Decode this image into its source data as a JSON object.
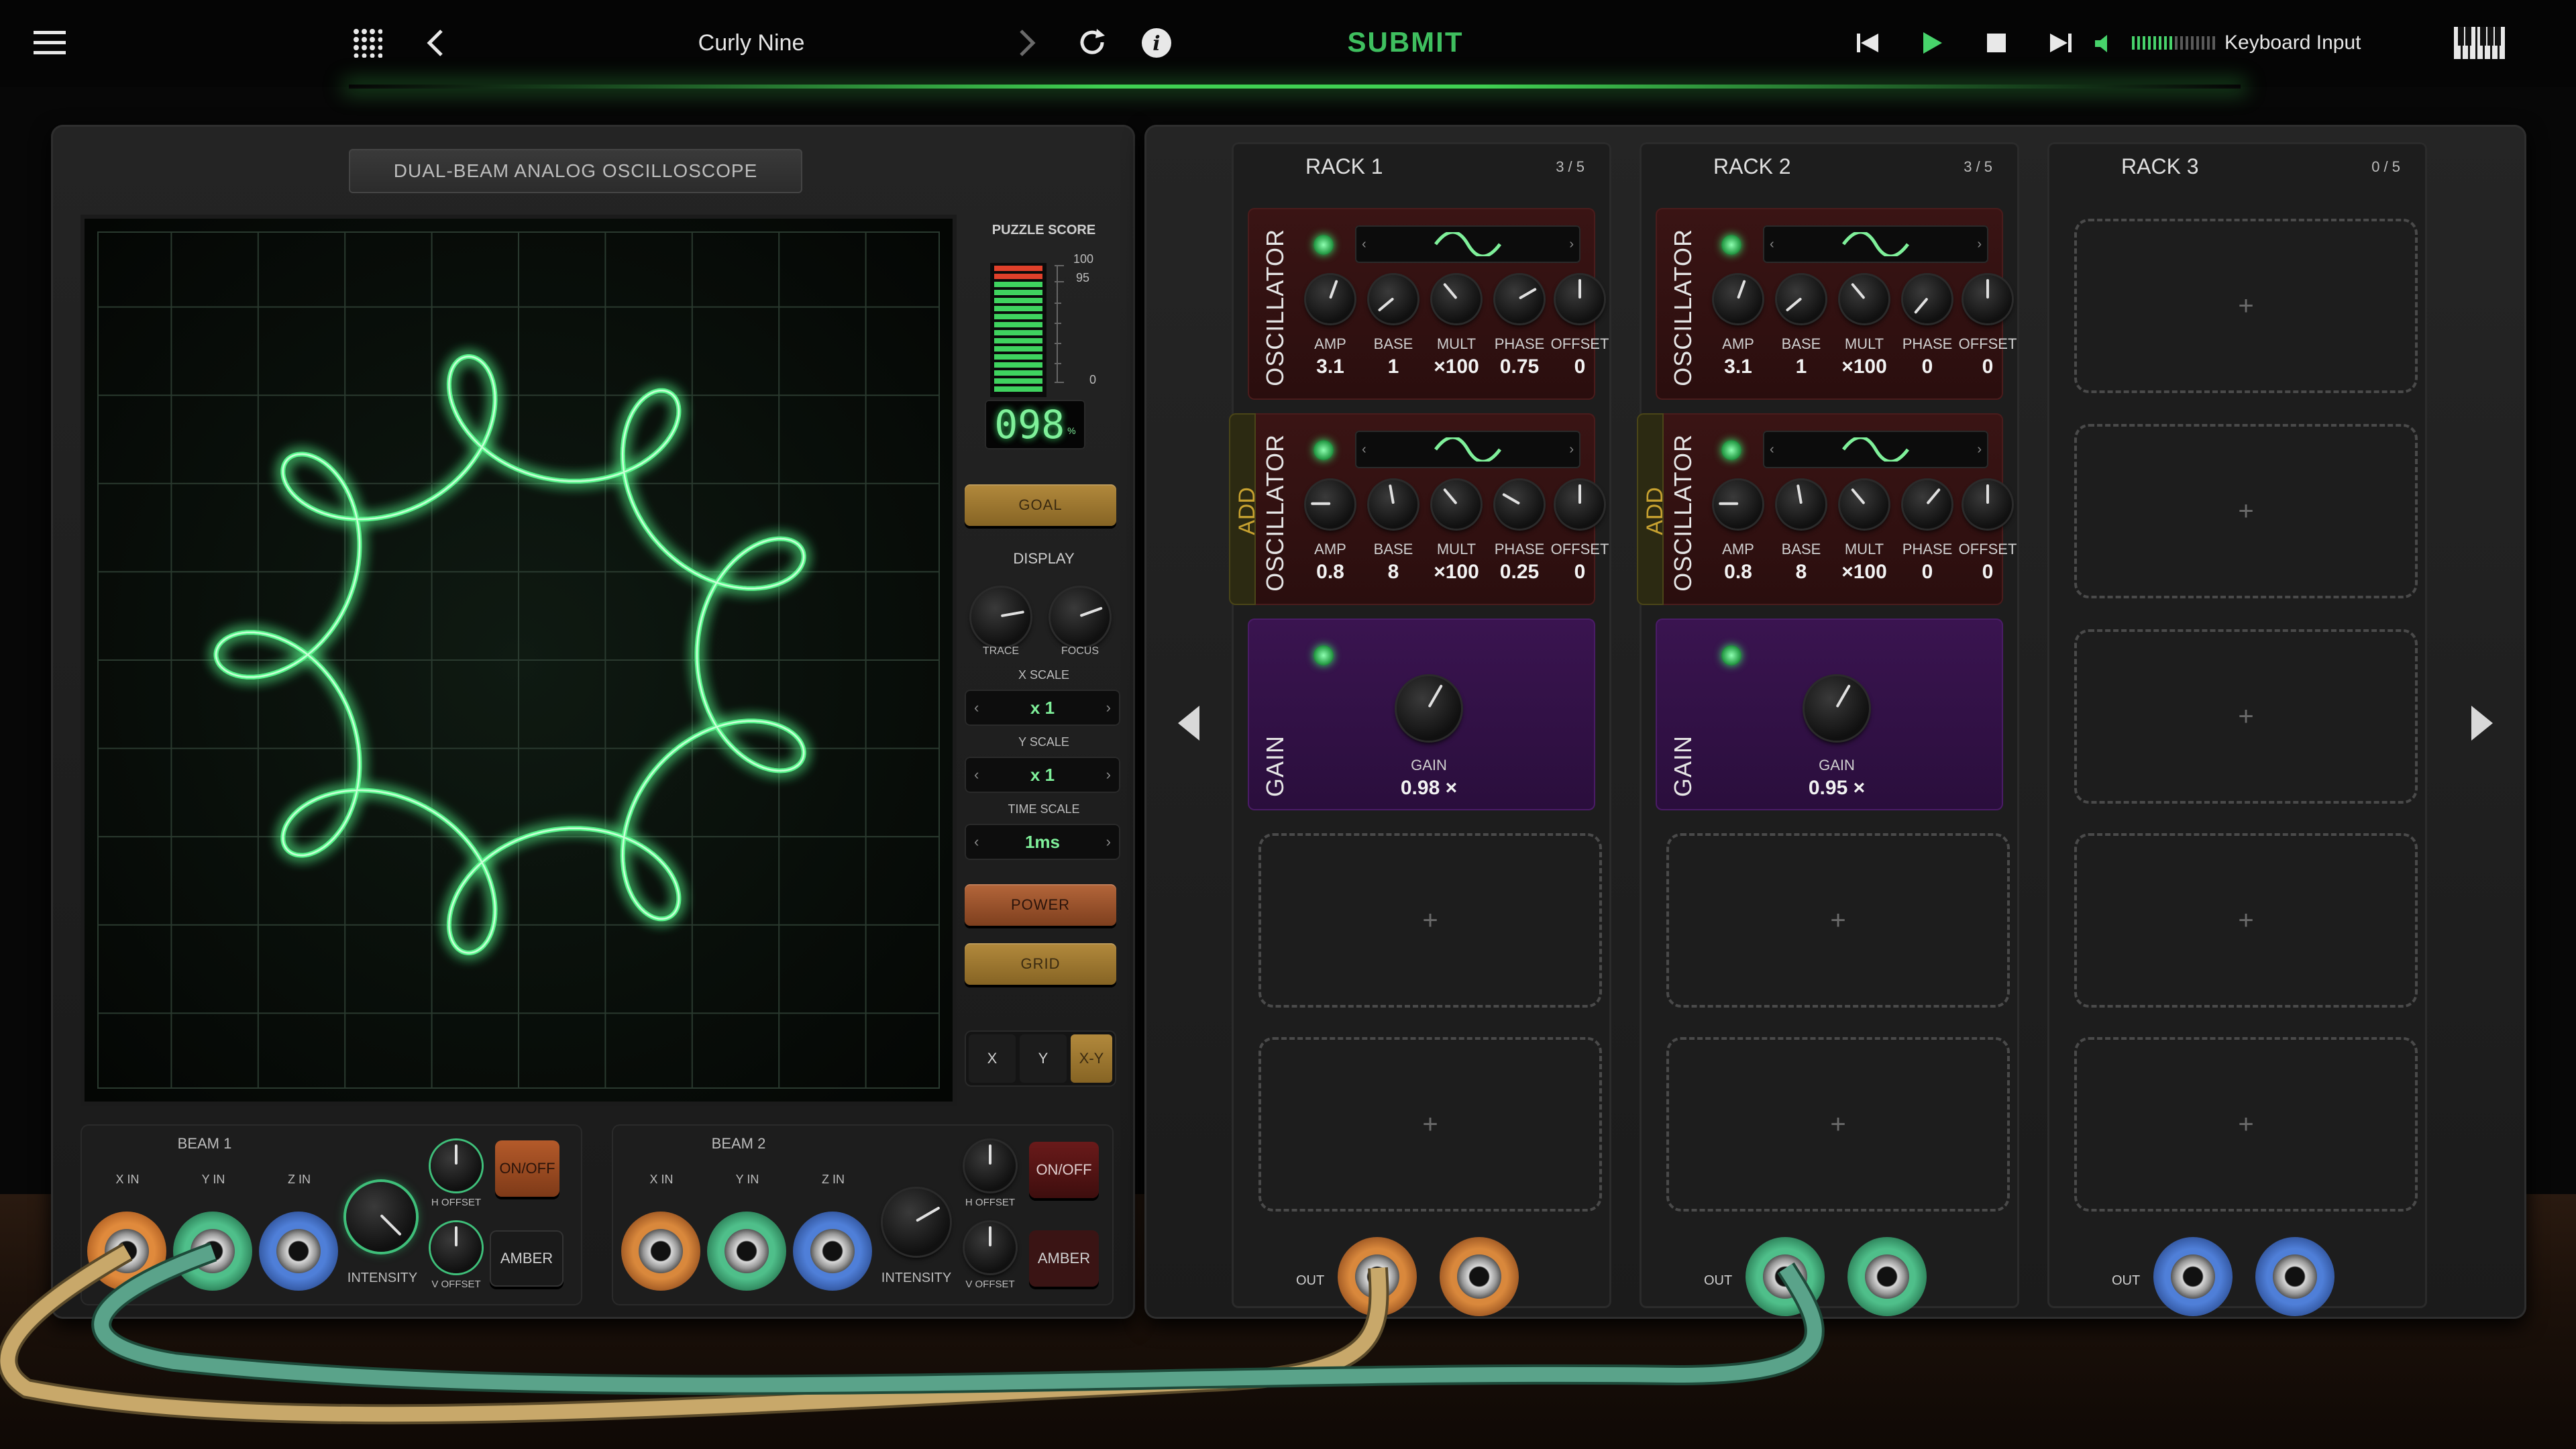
{
  "topbar": {
    "puzzle_title": "Curly Nine",
    "submit_label": "SUBMIT",
    "input_mode": "Keyboard Input"
  },
  "scope": {
    "label": "DUAL-BEAM ANALOG OSCILLOSCOPE",
    "score_label": "PUZZLE SCORE",
    "score_value": "098",
    "score_unit": "%",
    "meter_ticks": [
      "100",
      "95",
      "0"
    ],
    "meter_fill": 0.98,
    "goal_label": "GOAL",
    "display_label": "DISPLAY",
    "trace_label": "TRACE",
    "focus_label": "FOCUS",
    "xscale_label": "X SCALE",
    "xscale_value": "x 1",
    "yscale_label": "Y SCALE",
    "yscale_value": "x 1",
    "timescale_label": "TIME SCALE",
    "timescale_value": "1ms",
    "power_label": "POWER",
    "grid_label": "GRID",
    "mode_x": "X",
    "mode_y": "Y",
    "mode_xy": "X-Y",
    "beam1": {
      "title": "BEAM 1",
      "x_in": "X IN",
      "y_in": "Y IN",
      "z_in": "Z IN",
      "intensity": "INTENSITY",
      "h_offset": "H OFFSET",
      "v_offset": "V OFFSET",
      "onoff": "ON/OFF",
      "amber": "AMBER"
    },
    "beam2": {
      "title": "BEAM 2",
      "x_in": "X IN",
      "y_in": "Y IN",
      "z_in": "Z IN",
      "intensity": "INTENSITY",
      "h_offset": "H OFFSET",
      "v_offset": "V OFFSET",
      "onoff": "ON/OFF",
      "amber": "AMBER"
    }
  },
  "racks": [
    {
      "title": "RACK 1",
      "count": "3 / 5",
      "osc1": {
        "title": "OSCILLATOR",
        "amp": "3.1",
        "base": "1",
        "mult": "×100",
        "phase": "0.75",
        "offset": "0"
      },
      "osc2": {
        "title": "OSCILLATOR",
        "add": "ADD",
        "amp": "0.8",
        "base": "8",
        "mult": "×100",
        "phase": "0.25",
        "offset": "0"
      },
      "gain": {
        "title": "GAIN",
        "label": "GAIN",
        "value": "0.98 ×"
      },
      "out": "OUT"
    },
    {
      "title": "RACK 2",
      "count": "3 / 5",
      "osc1": {
        "title": "OSCILLATOR",
        "amp": "3.1",
        "base": "1",
        "mult": "×100",
        "phase": "0",
        "offset": "0"
      },
      "osc2": {
        "title": "OSCILLATOR",
        "add": "ADD",
        "amp": "0.8",
        "base": "8",
        "mult": "×100",
        "phase": "0",
        "offset": "0"
      },
      "gain": {
        "title": "GAIN",
        "label": "GAIN",
        "value": "0.95 ×"
      },
      "out": "OUT"
    },
    {
      "title": "RACK 3",
      "count": "0 / 5",
      "out": "OUT"
    }
  ],
  "knob_labels": {
    "amp": "AMP",
    "base": "BASE",
    "mult": "MULT",
    "phase": "PHASE",
    "offset": "OFFSET"
  },
  "slot_plus": "+",
  "colors": {
    "trace": "#57f58a",
    "submit": "#3fbf5f",
    "osc_bg": "#3a1414",
    "gain_bg": "#3a1450",
    "add_text": "#c8a230"
  },
  "icons": [
    "menu-icon",
    "grid-icon",
    "back-chevron-icon",
    "forward-chevron-icon",
    "reload-icon",
    "info-icon",
    "skip-back-icon",
    "play-icon",
    "stop-icon",
    "skip-forward-icon",
    "volume-icon",
    "piano-keys-icon",
    "wave-sine-icon",
    "plus-icon"
  ]
}
